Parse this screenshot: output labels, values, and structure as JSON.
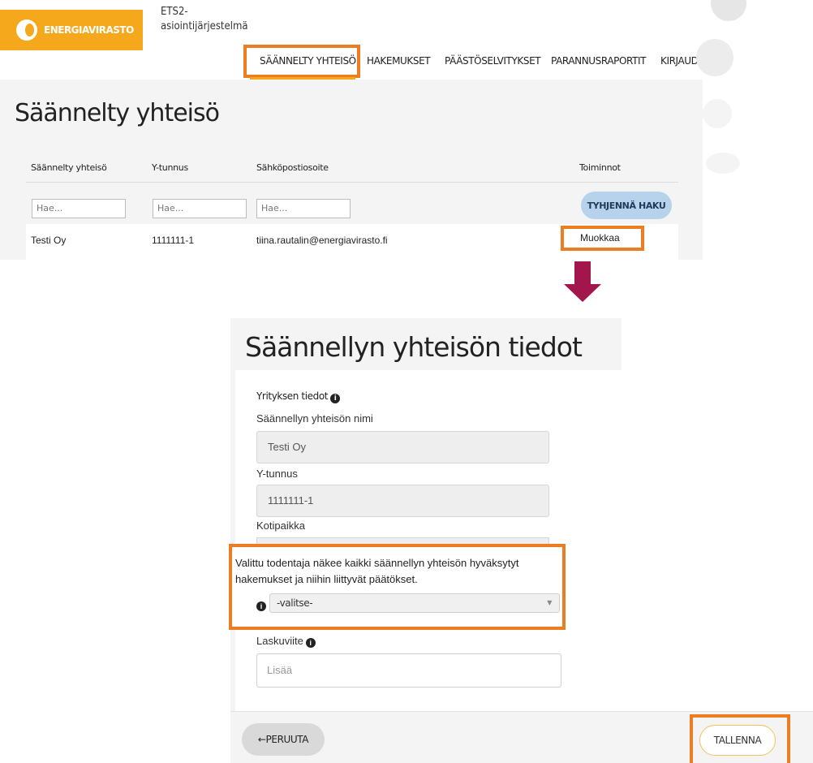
{
  "top": {
    "logo_text": "ENERGIAVIRASTO",
    "app_name": "ETS2-asiointijärjestelmä",
    "nav": [
      {
        "label": "SÄÄNNELTY YHTEISÖ"
      },
      {
        "label": "HAKEMUKSET"
      },
      {
        "label": "PÄÄSTÖSELVITYKSET"
      },
      {
        "label": "PARANNUSRAPORTIT"
      },
      {
        "label": "KIRJAUDU"
      }
    ],
    "page_title": "Säännelty yhteisö",
    "table": {
      "headers": [
        "Säännelty yhteisö",
        "Y-tunnus",
        "Sähköpostiosoite",
        "Toiminnot"
      ],
      "filter_placeholder": "Hae...",
      "clear_button": "TYHJENNÄ HAKU",
      "rows": [
        {
          "name": "Testi Oy",
          "business_id": "1111111-1",
          "email": "tiina.rautalin@energiavirasto.fi",
          "action": "Muokkaa"
        }
      ]
    }
  },
  "bottom": {
    "page_title": "Säännellyn yhteisön tiedot",
    "section_title": "Yrityksen tiedot",
    "fields": {
      "name_label": "Säännellyn yhteisön nimi",
      "name_value": "Testi Oy",
      "business_id_label": "Y-tunnus",
      "business_id_value": "1111111-1",
      "domicile_label": "Kotipaikka"
    },
    "verifier_note": "Valittu todentaja näkee kaikki säännellyn yhteisön hyväksytyt hakemukset ja niihin liittyvät päätökset.",
    "verifier_select_value": "-valitse-",
    "invoice_ref_label": "Laskuviite",
    "invoice_ref_placeholder": "Lisää",
    "cancel_button": "←PERUUTA",
    "save_button": "TALLENNA"
  },
  "colors": {
    "brand_orange": "#f5a81c",
    "highlight_orange": "#ed7d22",
    "arrow": "#a3154d",
    "clear_button_bg": "#b7d3ec"
  }
}
